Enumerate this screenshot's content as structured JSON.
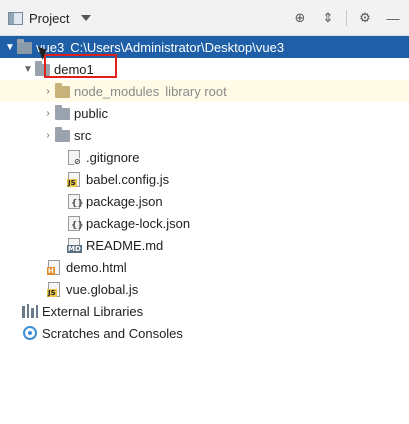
{
  "toolbar": {
    "title": "Project",
    "actions": [
      {
        "icon": "crosshair-icon",
        "glyph": "⊕"
      },
      {
        "icon": "collapse-all-icon",
        "glyph": "⇕"
      },
      {
        "icon": "gear-icon",
        "glyph": "⚙"
      },
      {
        "icon": "minimize-icon",
        "glyph": "—"
      }
    ]
  },
  "tree": {
    "root": {
      "name": "vue3",
      "path": "C:\\Users\\Administrator\\Desktop\\vue3"
    },
    "demo1": {
      "name": "demo1"
    },
    "node_modules": {
      "name": "node_modules",
      "tag": "library root"
    },
    "public": {
      "name": "public"
    },
    "src": {
      "name": "src"
    },
    "gitignore": {
      "name": ".gitignore"
    },
    "babel": {
      "name": "babel.config.js"
    },
    "package": {
      "name": "package.json"
    },
    "package_lock": {
      "name": "package-lock.json"
    },
    "readme": {
      "name": "README.md"
    },
    "demo_html": {
      "name": "demo.html"
    },
    "vue_global": {
      "name": "vue.global.js"
    },
    "external": {
      "name": "External Libraries"
    },
    "scratches": {
      "name": "Scratches and Consoles"
    }
  },
  "colors": {
    "selection": "#1f5fa8",
    "highlight_box": "#e0201c",
    "library_tag": "#8a8a8a"
  }
}
